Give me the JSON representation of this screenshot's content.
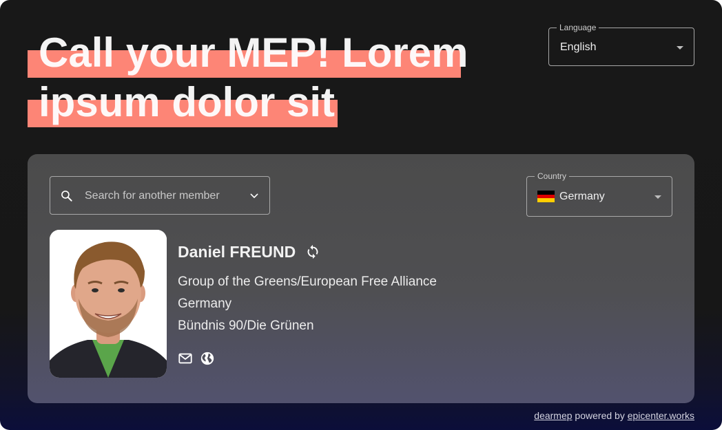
{
  "headline": {
    "line1": "Call your MEP! Lorem",
    "line2": "ipsum dolor sit",
    "highlight_color": "#fd8576"
  },
  "language_select": {
    "label": "Language",
    "value": "English",
    "icon": "caret-down-icon"
  },
  "search": {
    "placeholder": "Search for another member",
    "value": "",
    "icons": [
      "search-icon",
      "chevron-down-icon"
    ]
  },
  "country_select": {
    "label": "Country",
    "value": "Germany",
    "flag": "flag-de-icon",
    "flag_colors": [
      "#000000",
      "#dd0000",
      "#ffce00"
    ]
  },
  "mep": {
    "name": "Daniel FREUND",
    "group": "Group of the Greens/European Free Alliance",
    "country": "Germany",
    "party": "Bündnis 90/Die Grünen",
    "swap_icon": "swap-icon",
    "contact_icons": [
      "email-icon",
      "website-globe-icon"
    ]
  },
  "footer": {
    "brand_link": "dearmep",
    "powered_by": " powered by ",
    "org_link": "epicenter.works"
  }
}
